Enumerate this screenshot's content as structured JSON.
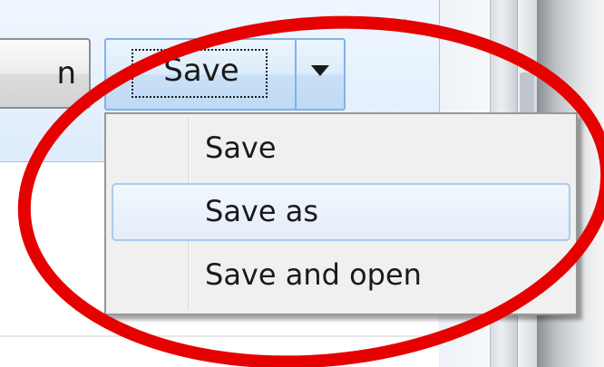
{
  "toolbar": {
    "open_label": "n",
    "save_label": "Save",
    "split_arrow_icon": "triangle-down-icon",
    "close_icon": "close-icon"
  },
  "menu": {
    "items": [
      {
        "label": "Save",
        "hovered": false
      },
      {
        "label": "Save as",
        "hovered": true
      },
      {
        "label": "Save and open",
        "hovered": false
      }
    ]
  },
  "annotation": {
    "shape": "ellipse",
    "color": "#e60000"
  },
  "colors": {
    "bar_background": "#deecfb",
    "split_button_border": "#7eb4ea",
    "menu_background": "#f0f0f0",
    "menu_hover_border": "#a8cbee"
  }
}
